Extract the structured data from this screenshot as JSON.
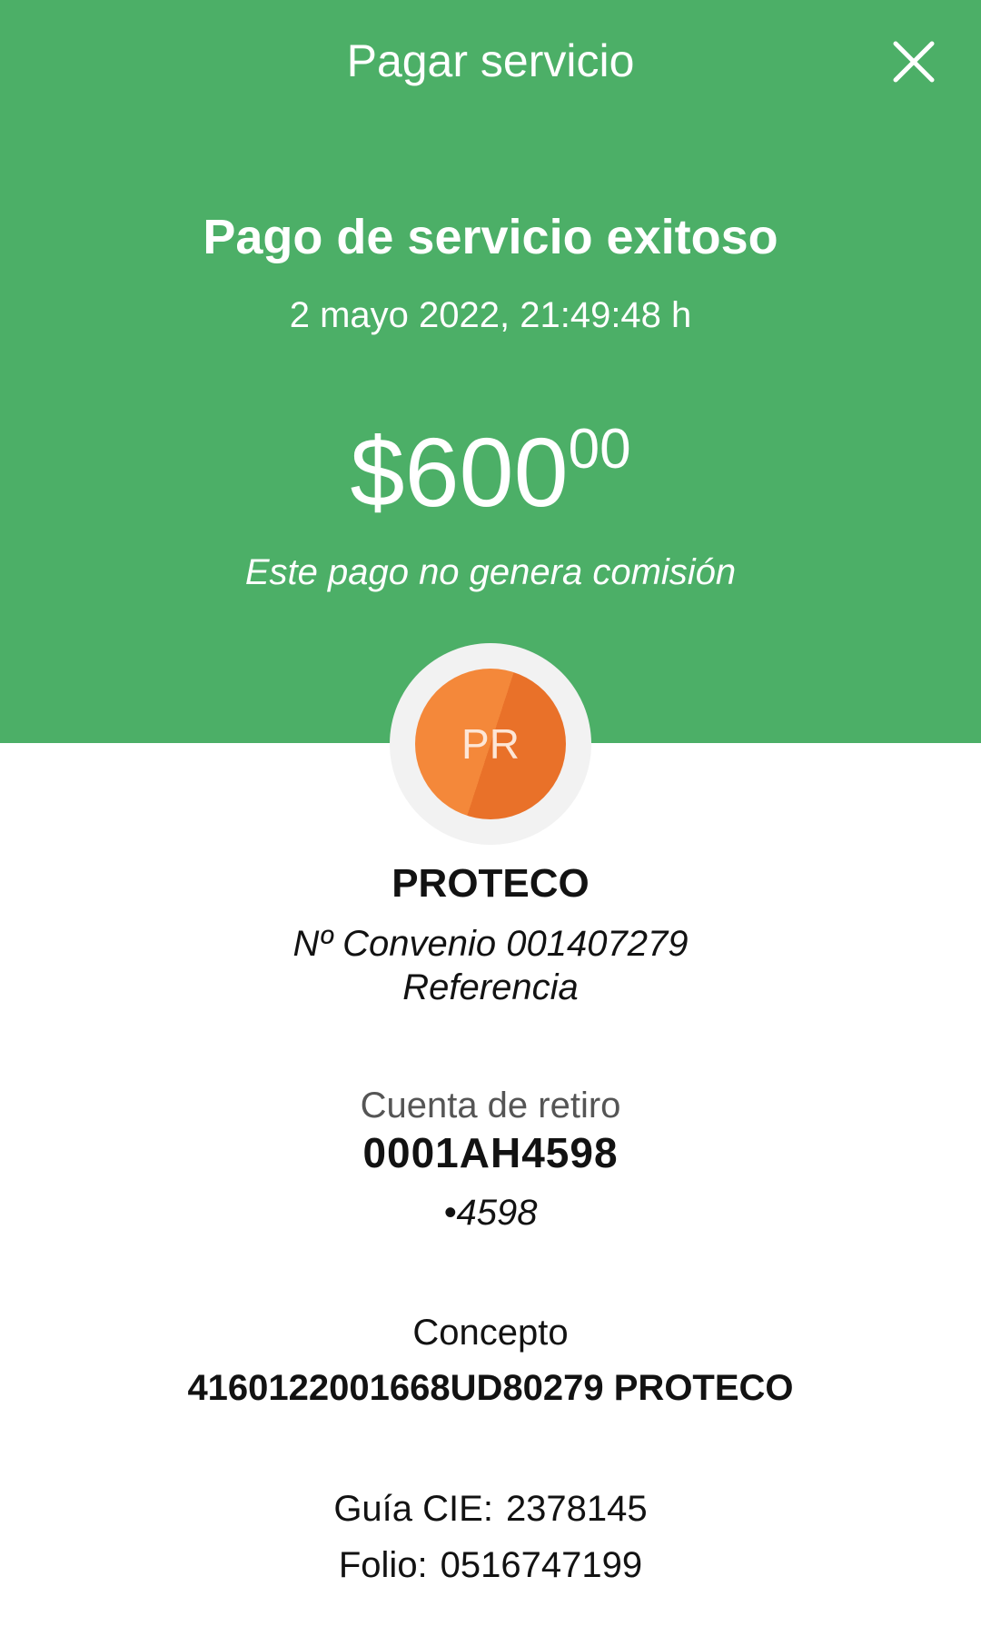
{
  "topbar": {
    "title": "Pagar servicio",
    "close_icon": "close-icon"
  },
  "summary": {
    "title": "Pago de servicio exitoso",
    "datetime": "2 mayo 2022, 21:49:48 h",
    "amount_main": "$600",
    "amount_cents": "00",
    "commission_note": "Este pago no genera comisión"
  },
  "biller": {
    "initials": "PR",
    "name": "PROTECO",
    "convenio": "Nº Convenio 001407279",
    "referencia": "Referencia"
  },
  "account": {
    "label": "Cuenta de retiro",
    "value": "0001AH4598",
    "masked": "•4598"
  },
  "concept": {
    "label": "Concepto",
    "value": "4160122001668UD80279 PROTECO"
  },
  "references": {
    "cie_label": "Guía CIE:",
    "cie_value": "2378145",
    "folio_label": "Folio:",
    "folio_value": "0516747199"
  },
  "colors": {
    "header_bg": "#4caf67",
    "avatar_orange": "#f4883a",
    "avatar_orange_dark": "#e97129"
  }
}
